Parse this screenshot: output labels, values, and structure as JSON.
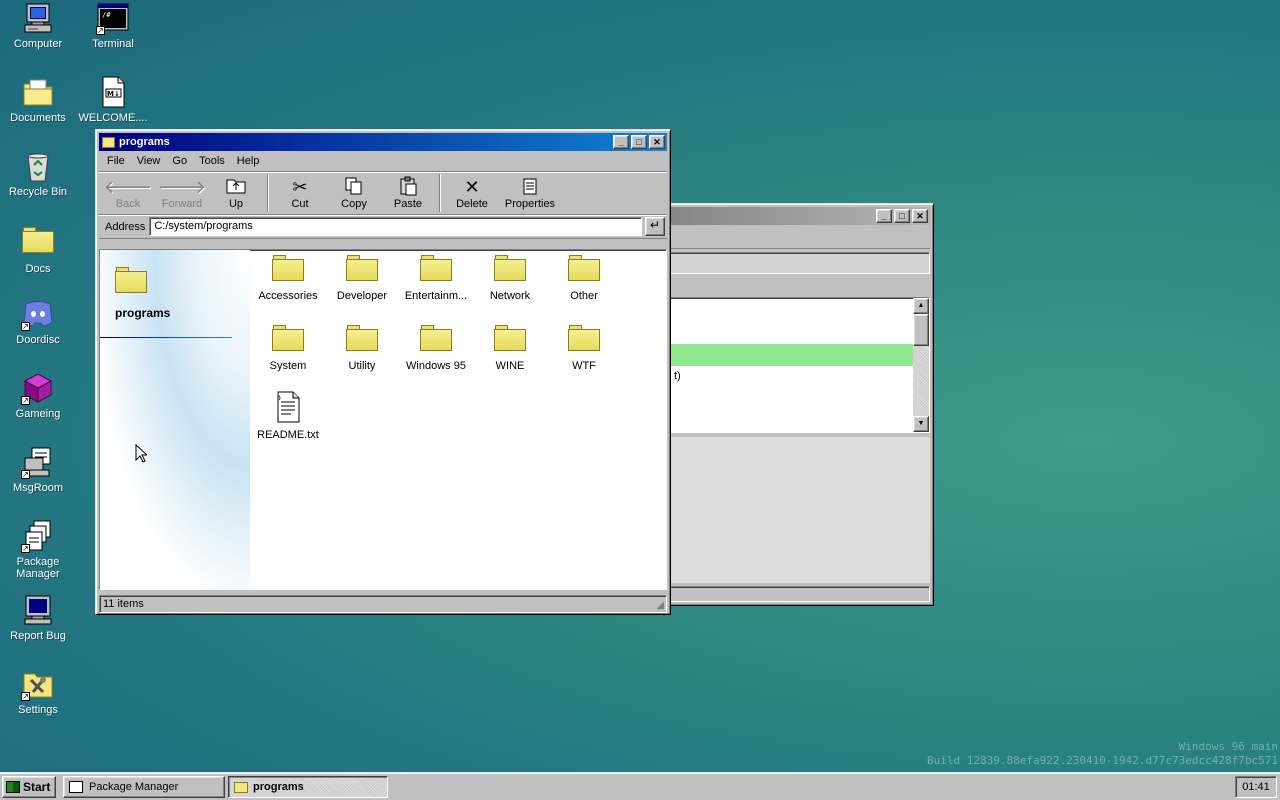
{
  "desktop": {
    "icons": [
      {
        "label": "Computer",
        "icon": "computer-icon"
      },
      {
        "label": "Terminal",
        "icon": "terminal-icon"
      },
      {
        "label": "Documents",
        "icon": "documents-folder-icon"
      },
      {
        "label": "WELCOME....",
        "icon": "markdown-file-icon"
      },
      {
        "label": "Recycle Bin",
        "icon": "recycle-bin-icon"
      },
      {
        "label": "Docs",
        "icon": "folder-icon"
      },
      {
        "label": "Doordisc",
        "icon": "discord-icon"
      },
      {
        "label": "Gameing",
        "icon": "cube-icon"
      },
      {
        "label": "MsgRoom",
        "icon": "msgroom-icon"
      },
      {
        "label": "Package Manager",
        "icon": "package-icon"
      },
      {
        "label": "Report Bug",
        "icon": "monitor-bug-icon"
      },
      {
        "label": "Settings",
        "icon": "settings-folder-icon"
      }
    ],
    "build_line1": "Windows 96 main",
    "build_line2": "Build 12839.88efa922.230410-1942.d77c73edcc428f7bc571"
  },
  "explorer": {
    "title": "programs",
    "menu": [
      "File",
      "View",
      "Go",
      "Tools",
      "Help"
    ],
    "toolbar": {
      "back": "Back",
      "forward": "Forward",
      "up": "Up",
      "cut": "Cut",
      "copy": "Copy",
      "paste": "Paste",
      "delete": "Delete",
      "properties": "Properties"
    },
    "address_label": "Address",
    "address_value": "C:/system/programs",
    "side_title": "programs",
    "items": [
      {
        "label": "Accessories",
        "type": "folder"
      },
      {
        "label": "Developer",
        "type": "folder"
      },
      {
        "label": "Entertainm...",
        "type": "folder"
      },
      {
        "label": "Network",
        "type": "folder"
      },
      {
        "label": "Other",
        "type": "folder"
      },
      {
        "label": "System",
        "type": "folder"
      },
      {
        "label": "Utility",
        "type": "folder"
      },
      {
        "label": "Windows 95",
        "type": "folder"
      },
      {
        "label": "WINE",
        "type": "folder"
      },
      {
        "label": "WTF",
        "type": "folder"
      },
      {
        "label": "README.txt",
        "type": "file"
      }
    ],
    "status": "11 items"
  },
  "background_window": {
    "partial_text": "t)",
    "highlight_color": "#90e890"
  },
  "taskbar": {
    "start_label": "Start",
    "tasks": [
      {
        "label": "Package Manager",
        "active": false
      },
      {
        "label": "programs",
        "active": true
      }
    ],
    "clock": "01:41"
  }
}
